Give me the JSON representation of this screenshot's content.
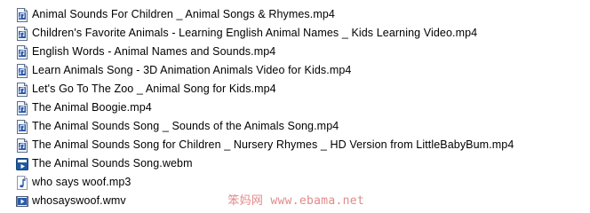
{
  "files": [
    {
      "name": "Animal Sounds For Children _ Animal Songs & Rhymes.mp4",
      "icon": "video-file-icon"
    },
    {
      "name": "Children's Favorite Animals - Learning English Animal Names _ Kids Learning Video.mp4",
      "icon": "video-file-icon"
    },
    {
      "name": "English Words - Animal Names and Sounds.mp4",
      "icon": "video-file-icon"
    },
    {
      "name": "Learn Animals Song - 3D Animation Animals Video for Kids.mp4",
      "icon": "video-file-icon"
    },
    {
      "name": "Let's Go To The Zoo _ Animal Song for Kids.mp4",
      "icon": "video-file-icon"
    },
    {
      "name": "The Animal Boogie.mp4",
      "icon": "video-file-icon"
    },
    {
      "name": "The Animal Sounds Song _ Sounds of the Animals Song.mp4",
      "icon": "video-file-icon"
    },
    {
      "name": "The Animal Sounds Song for Children _ Nursery Rhymes _ HD Version from LittleBabyBum.mp4",
      "icon": "video-file-icon"
    },
    {
      "name": "The Animal Sounds Song.webm",
      "icon": "webm-file-icon"
    },
    {
      "name": "who says woof.mp3",
      "icon": "audio-file-icon"
    },
    {
      "name": "whosayswoof.wmv",
      "icon": "wmv-file-icon"
    }
  ],
  "watermark": "笨妈网 www.ebama.net",
  "colors": {
    "watermark": "#e08a8a",
    "icon_blue": "#2a5aa8",
    "icon_border": "#5a6f8c",
    "webm_icon": "#1e5aa0"
  }
}
